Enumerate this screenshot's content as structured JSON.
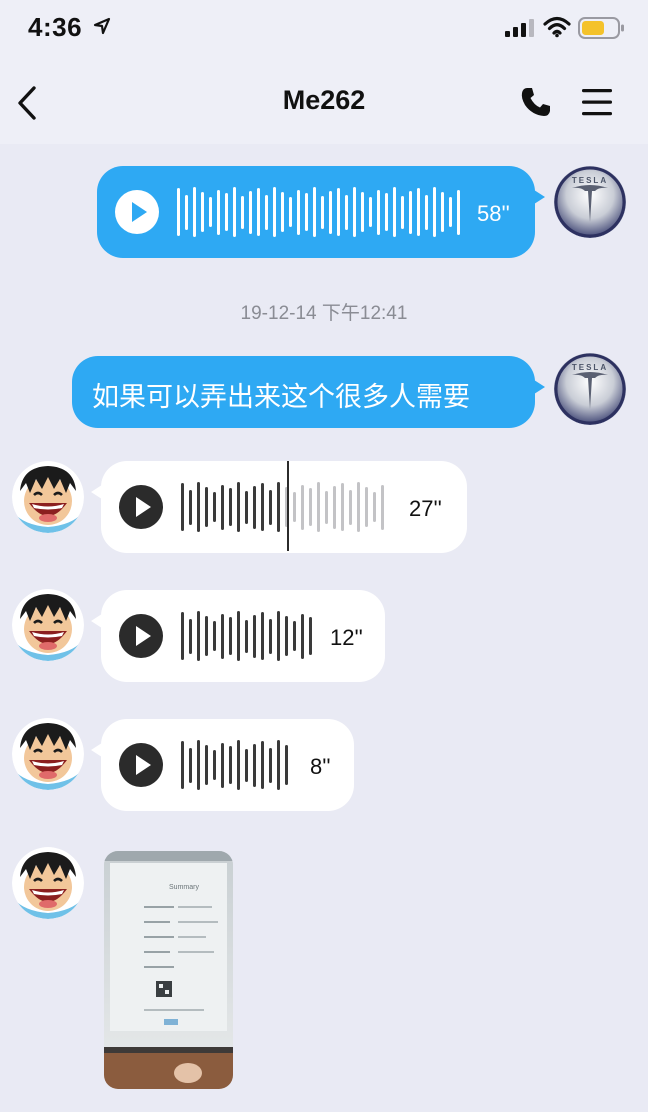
{
  "status_bar": {
    "time": "4:36"
  },
  "nav": {
    "title": "Me262"
  },
  "messages": {
    "m1": {
      "duration": "58''"
    },
    "timestamp": "19-12-14 下午12:41",
    "m2": {
      "text": "如果可以弄出来这个很多人需要"
    },
    "m3": {
      "duration": "27''",
      "playback_progress": 0.5
    },
    "m4": {
      "duration": "12''"
    },
    "m5": {
      "duration": "8''"
    }
  },
  "photo": {
    "text": "Summary"
  },
  "avatars": {
    "tesla_logo_text": "TESLA"
  },
  "colors": {
    "outgoing_bubble": "#2ea9f3",
    "incoming_bubble": "#ffffff",
    "background": "#e9eaf4"
  }
}
